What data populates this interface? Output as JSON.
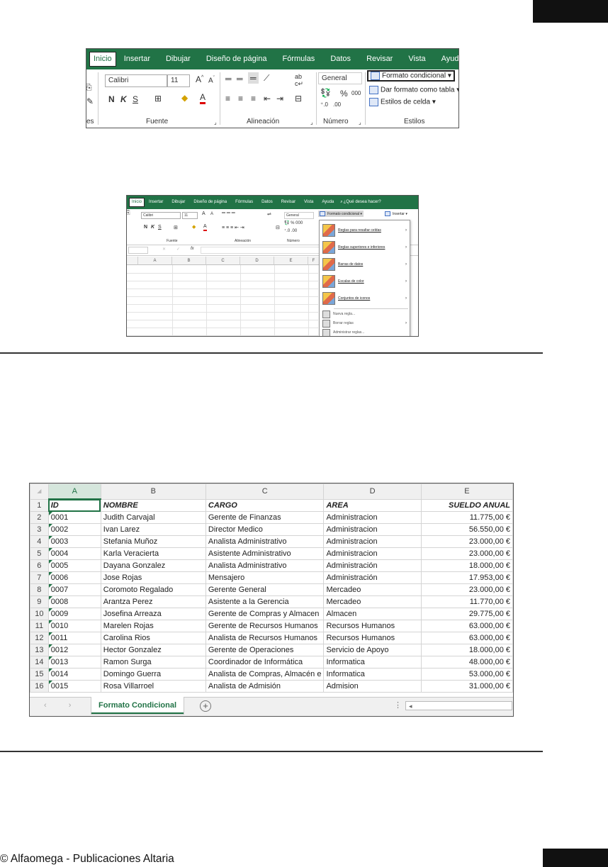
{
  "ribbon": {
    "tabs": [
      "Inicio",
      "Insertar",
      "Dibujar",
      "Diseño de página",
      "Fórmulas",
      "Datos",
      "Revisar",
      "Vista",
      "Ayuda"
    ],
    "font_name": "Calibri",
    "font_size": "11",
    "bold": "N",
    "italic": "K",
    "underline": "S",
    "number_format": "General",
    "percent": "%",
    "thousands": "000",
    "conditional_format": "Formato condicional",
    "format_as_table": "Dar formato como tabla",
    "cell_styles": "Estilos de celda",
    "groups": {
      "clipboard_partial": "es",
      "font": "Fuente",
      "alignment": "Alineación",
      "number": "Número",
      "styles": "Estilos"
    }
  },
  "ribbon2": {
    "tabs": [
      "Inicio",
      "Insertar",
      "Dibujar",
      "Diseño de página",
      "Fórmulas",
      "Datos",
      "Revisar",
      "Vista",
      "Ayuda"
    ],
    "search": "¿Qué desea hacer?",
    "font_name": "Calibri",
    "font_size": "11",
    "number_format": "General",
    "conditional_format": "Formato condicional",
    "insert": "Insertar",
    "groups": {
      "font": "Fuente",
      "alignment": "Alineación",
      "number": "Número"
    },
    "formula_fx": "fx",
    "columns": [
      "A",
      "B",
      "C",
      "D",
      "E",
      "F"
    ],
    "menu": {
      "items": [
        "Reglas para resaltar celdas",
        "Reglas superiores e inferiores",
        "Barras de datos",
        "Escalas de color",
        "Conjuntos de iconos"
      ],
      "actions": [
        "Nueva regla...",
        "Borrar reglas",
        "Administrar reglas..."
      ]
    }
  },
  "sheet": {
    "columns": [
      "A",
      "B",
      "C",
      "D",
      "E"
    ],
    "headers": [
      "ID",
      "NOMBRE",
      "CARGO",
      "AREA",
      "SUELDO ANUAL"
    ],
    "rows": [
      [
        "2",
        "0001",
        "Judith Carvajal",
        "Gerente de Finanzas",
        "Administracion",
        "11.775,00 €"
      ],
      [
        "3",
        "0002",
        "Ivan Larez",
        "Director Medico",
        "Administracion",
        "56.550,00 €"
      ],
      [
        "4",
        "0003",
        "Stefania Muñoz",
        "Analista Administrativo",
        "Administracion",
        "23.000,00 €"
      ],
      [
        "5",
        "0004",
        "Karla Veracierta",
        "Asistente Administrativo",
        "Administracion",
        "23.000,00 €"
      ],
      [
        "6",
        "0005",
        "Dayana Gonzalez",
        "Analista Administrativo",
        "Administración",
        "18.000,00 €"
      ],
      [
        "7",
        "0006",
        "Jose Rojas",
        "Mensajero",
        "Administración",
        "17.953,00 €"
      ],
      [
        "8",
        "0007",
        "Coromoto Regalado",
        "Gerente General",
        "Mercadeo",
        "23.000,00 €"
      ],
      [
        "9",
        "0008",
        "Arantza Perez",
        "Asistente a la Gerencia",
        "Mercadeo",
        "11.770,00 €"
      ],
      [
        "10",
        "0009",
        "Josefina Arreaza",
        "Gerente de Compras y Almacen",
        "Almacen",
        "29.775,00 €"
      ],
      [
        "11",
        "0010",
        "Marelen Rojas",
        "Gerente de Recursos Humanos",
        "Recursos Humanos",
        "63.000,00 €"
      ],
      [
        "12",
        "0011",
        "Carolina Rios",
        "Analista de Recursos Humanos",
        "Recursos Humanos",
        "63.000,00 €"
      ],
      [
        "13",
        "0012",
        "Hector Gonzalez",
        "Gerente de Operaciones",
        "Servicio de Apoyo",
        "18.000,00 €"
      ],
      [
        "14",
        "0013",
        "Ramon Surga",
        "Coordinador de Informática",
        "Informatica",
        "48.000,00 €"
      ],
      [
        "15",
        "0014",
        "Domingo Guerra",
        "Analista de Compras, Almacén e",
        "Informatica",
        "53.000,00 €"
      ],
      [
        "16",
        "0015",
        "Rosa Villarroel",
        "Analista de Admisión",
        "Admision",
        "31.000,00 €"
      ]
    ],
    "sheet_tab": "Formato Condicional"
  },
  "footer": "© Alfaomega - Publicaciones Altaria"
}
